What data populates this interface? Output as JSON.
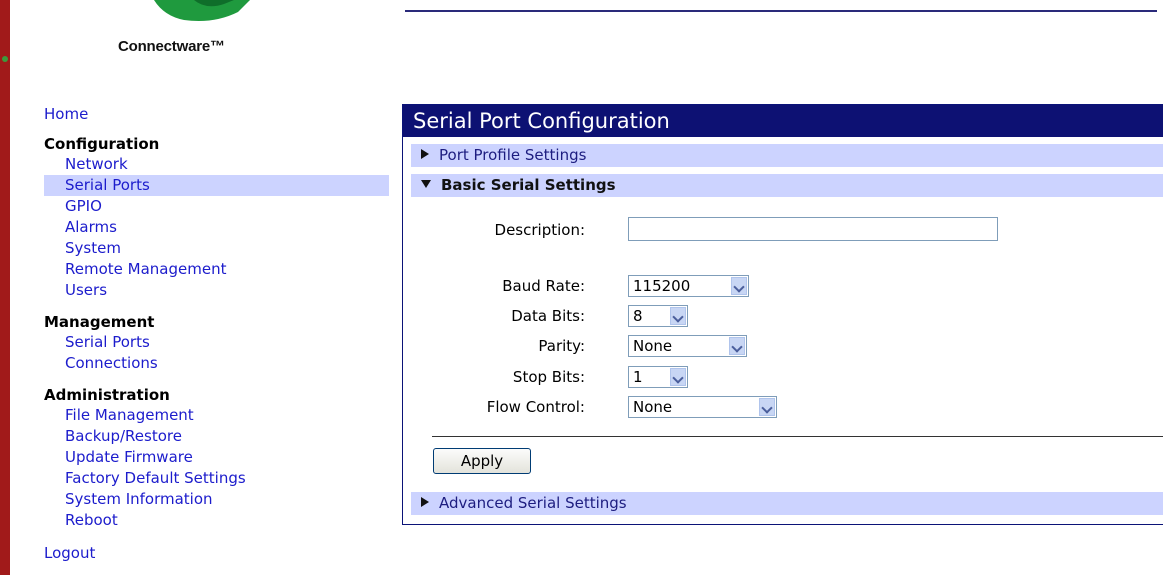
{
  "logo": {
    "brand": "Connectware™"
  },
  "nav": {
    "home": "Home",
    "configuration": {
      "heading": "Configuration",
      "items": [
        "Network",
        "Serial Ports",
        "GPIO",
        "Alarms",
        "System",
        "Remote Management",
        "Users"
      ],
      "active": "Serial Ports"
    },
    "management": {
      "heading": "Management",
      "items": [
        "Serial Ports",
        "Connections"
      ]
    },
    "administration": {
      "heading": "Administration",
      "items": [
        "File Management",
        "Backup/Restore",
        "Update Firmware",
        "Factory Default Settings",
        "System Information",
        "Reboot"
      ]
    },
    "logout": "Logout"
  },
  "panel": {
    "title": "Serial Port Configuration",
    "sections": {
      "port_profile": "Port Profile Settings",
      "basic": "Basic Serial Settings",
      "advanced": "Advanced Serial Settings"
    },
    "form": {
      "description_label": "Description:",
      "description_value": "",
      "baud_rate_label": "Baud Rate:",
      "baud_rate_value": "115200",
      "data_bits_label": "Data Bits:",
      "data_bits_value": "8",
      "parity_label": "Parity:",
      "parity_value": "None",
      "stop_bits_label": "Stop Bits:",
      "stop_bits_value": "1",
      "flow_control_label": "Flow Control:",
      "flow_control_value": "None"
    },
    "apply_label": "Apply"
  },
  "colors": {
    "title_bar": "#0d1173",
    "section_bar": "#ccd3ff",
    "link": "#1c1ccc",
    "side_stripe": "#a11a1a"
  }
}
